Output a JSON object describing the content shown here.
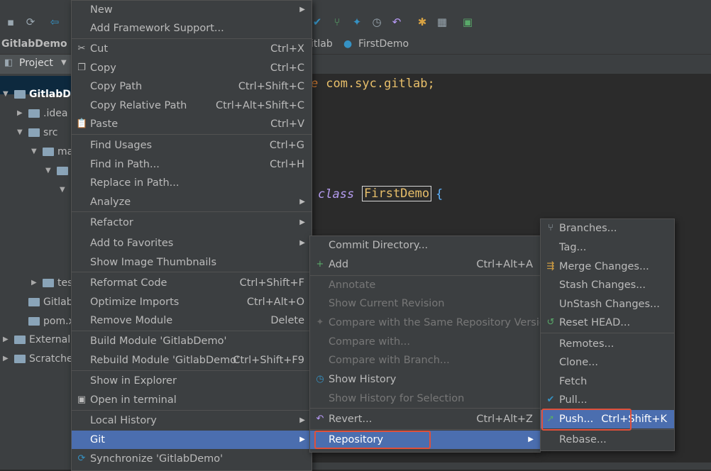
{
  "nav": {
    "project": "GitlabDemo",
    "package_crumb": "itlab",
    "file_crumb": "FirstDemo"
  },
  "project_panel": {
    "view_label": "Project",
    "tree": [
      {
        "label": "GitlabDe",
        "indent": 0
      },
      {
        "label": ".idea",
        "indent": 1
      },
      {
        "label": "src",
        "indent": 1
      },
      {
        "label": "ma",
        "indent": 2
      },
      {
        "label": "",
        "indent": 3
      },
      {
        "label": "",
        "indent": 4
      },
      {
        "label": "tes",
        "indent": 2
      },
      {
        "label": "Gitlab",
        "indent": 1
      },
      {
        "label": "pom.x",
        "indent": 1
      },
      {
        "label": "External",
        "indent": 0
      },
      {
        "label": "Scratche",
        "indent": 0
      }
    ]
  },
  "editor": {
    "line1_kw": "e",
    "line1_rest": " com.syc.gitlab;",
    "line2_kw": "class",
    "line2_name": "FirstDemo",
    "line2_brace": "{"
  },
  "context_menu": {
    "items": [
      {
        "label": "New",
        "shortcut": "",
        "submenu": true,
        "icon": ""
      },
      {
        "label": "Add Framework Support...",
        "shortcut": "",
        "submenu": false,
        "icon": ""
      },
      {
        "label": "Cut",
        "shortcut": "Ctrl+X",
        "submenu": false,
        "icon": "scissors-icon"
      },
      {
        "label": "Copy",
        "shortcut": "Ctrl+C",
        "submenu": false,
        "icon": "copy-icon"
      },
      {
        "label": "Copy Path",
        "shortcut": "Ctrl+Shift+C",
        "submenu": false,
        "icon": ""
      },
      {
        "label": "Copy Relative Path",
        "shortcut": "Ctrl+Alt+Shift+C",
        "submenu": false,
        "icon": ""
      },
      {
        "label": "Paste",
        "shortcut": "Ctrl+V",
        "submenu": false,
        "icon": "paste-icon"
      },
      {
        "label": "Find Usages",
        "shortcut": "Ctrl+G",
        "submenu": false,
        "icon": ""
      },
      {
        "label": "Find in Path...",
        "shortcut": "Ctrl+H",
        "submenu": false,
        "icon": ""
      },
      {
        "label": "Replace in Path...",
        "shortcut": "",
        "submenu": false,
        "icon": ""
      },
      {
        "label": "Analyze",
        "shortcut": "",
        "submenu": true,
        "icon": ""
      },
      {
        "label": "Refactor",
        "shortcut": "",
        "submenu": true,
        "icon": ""
      },
      {
        "label": "Add to Favorites",
        "shortcut": "",
        "submenu": true,
        "icon": ""
      },
      {
        "label": "Show Image Thumbnails",
        "shortcut": "",
        "submenu": false,
        "icon": ""
      },
      {
        "label": "Reformat Code",
        "shortcut": "Ctrl+Shift+F",
        "submenu": false,
        "icon": ""
      },
      {
        "label": "Optimize Imports",
        "shortcut": "Ctrl+Alt+O",
        "submenu": false,
        "icon": ""
      },
      {
        "label": "Remove Module",
        "shortcut": "Delete",
        "submenu": false,
        "icon": ""
      },
      {
        "label": "Build Module 'GitlabDemo'",
        "shortcut": "",
        "submenu": false,
        "icon": ""
      },
      {
        "label": "Rebuild Module 'GitlabDemo'",
        "shortcut": "Ctrl+Shift+F9",
        "submenu": false,
        "icon": ""
      },
      {
        "label": "Show in Explorer",
        "shortcut": "",
        "submenu": false,
        "icon": ""
      },
      {
        "label": "Open in terminal",
        "shortcut": "",
        "submenu": false,
        "icon": "terminal-icon"
      },
      {
        "label": "Local History",
        "shortcut": "",
        "submenu": true,
        "icon": ""
      },
      {
        "label": "Git",
        "shortcut": "",
        "submenu": true,
        "icon": "",
        "selected": true
      },
      {
        "label": "Synchronize 'GitlabDemo'",
        "shortcut": "",
        "submenu": false,
        "icon": "sync-icon"
      }
    ]
  },
  "git_menu": {
    "items": [
      {
        "label": "Commit Directory...",
        "shortcut": "",
        "disabled": false,
        "icon": ""
      },
      {
        "label": "Add",
        "shortcut": "Ctrl+Alt+A",
        "disabled": false,
        "icon": "plus-icon"
      },
      {
        "label": "Annotate",
        "shortcut": "",
        "disabled": true,
        "icon": ""
      },
      {
        "label": "Show Current Revision",
        "shortcut": "",
        "disabled": true,
        "icon": ""
      },
      {
        "label": "Compare with the Same Repository Version",
        "shortcut": "",
        "disabled": true,
        "icon": "compare-icon"
      },
      {
        "label": "Compare with...",
        "shortcut": "",
        "disabled": true,
        "icon": ""
      },
      {
        "label": "Compare with Branch...",
        "shortcut": "",
        "disabled": true,
        "icon": ""
      },
      {
        "label": "Show History",
        "shortcut": "",
        "disabled": false,
        "icon": "history-icon"
      },
      {
        "label": "Show History for Selection",
        "shortcut": "",
        "disabled": true,
        "icon": ""
      },
      {
        "label": "Revert...",
        "shortcut": "Ctrl+Alt+Z",
        "disabled": false,
        "icon": "revert-icon"
      },
      {
        "label": "Repository",
        "shortcut": "",
        "disabled": false,
        "icon": "",
        "submenu": true,
        "selected": true
      }
    ]
  },
  "repo_menu": {
    "items": [
      {
        "label": "Branches...",
        "shortcut": "",
        "icon": "branch-icon"
      },
      {
        "label": "Tag...",
        "shortcut": "",
        "icon": ""
      },
      {
        "label": "Merge Changes...",
        "shortcut": "",
        "icon": "merge-icon"
      },
      {
        "label": "Stash Changes...",
        "shortcut": "",
        "icon": ""
      },
      {
        "label": "UnStash Changes...",
        "shortcut": "",
        "icon": ""
      },
      {
        "label": "Reset HEAD...",
        "shortcut": "",
        "icon": "reset-icon"
      },
      {
        "label": "Remotes...",
        "shortcut": "",
        "icon": ""
      },
      {
        "label": "Clone...",
        "shortcut": "",
        "icon": ""
      },
      {
        "label": "Fetch",
        "shortcut": "",
        "icon": ""
      },
      {
        "label": "Pull...",
        "shortcut": "",
        "icon": "pull-icon"
      },
      {
        "label": "Push...",
        "shortcut": "Ctrl+Shift+K",
        "icon": "push-icon",
        "selected": true
      },
      {
        "label": "Rebase...",
        "shortcut": "",
        "icon": ""
      }
    ]
  },
  "colors": {
    "menu_bg": "#3c3f41",
    "selection": "#4b6eaf",
    "highlight_box": "#e0503a",
    "editor_bg": "#2b2b2b"
  }
}
